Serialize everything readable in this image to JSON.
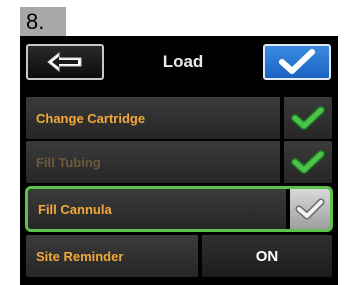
{
  "step_label": "8.",
  "header": {
    "title": "Load"
  },
  "icons": {
    "back": "left-arrow-icon",
    "confirm": "checkmark-icon"
  },
  "rows": [
    {
      "label": "Change Cartridge",
      "status": "complete",
      "check_color": "#4cc44a"
    },
    {
      "label": "Fill Tubing",
      "status": "complete",
      "check_color": "#4cc44a"
    },
    {
      "label": "Fill Cannula",
      "status": "selected",
      "check_color": "#f2f2f2"
    },
    {
      "label": "Site Reminder",
      "value": "ON"
    }
  ],
  "colors": {
    "accent_label": "#f3a93a",
    "confirm_button": "#2a75d6",
    "selection_border": "#5ec14e"
  }
}
